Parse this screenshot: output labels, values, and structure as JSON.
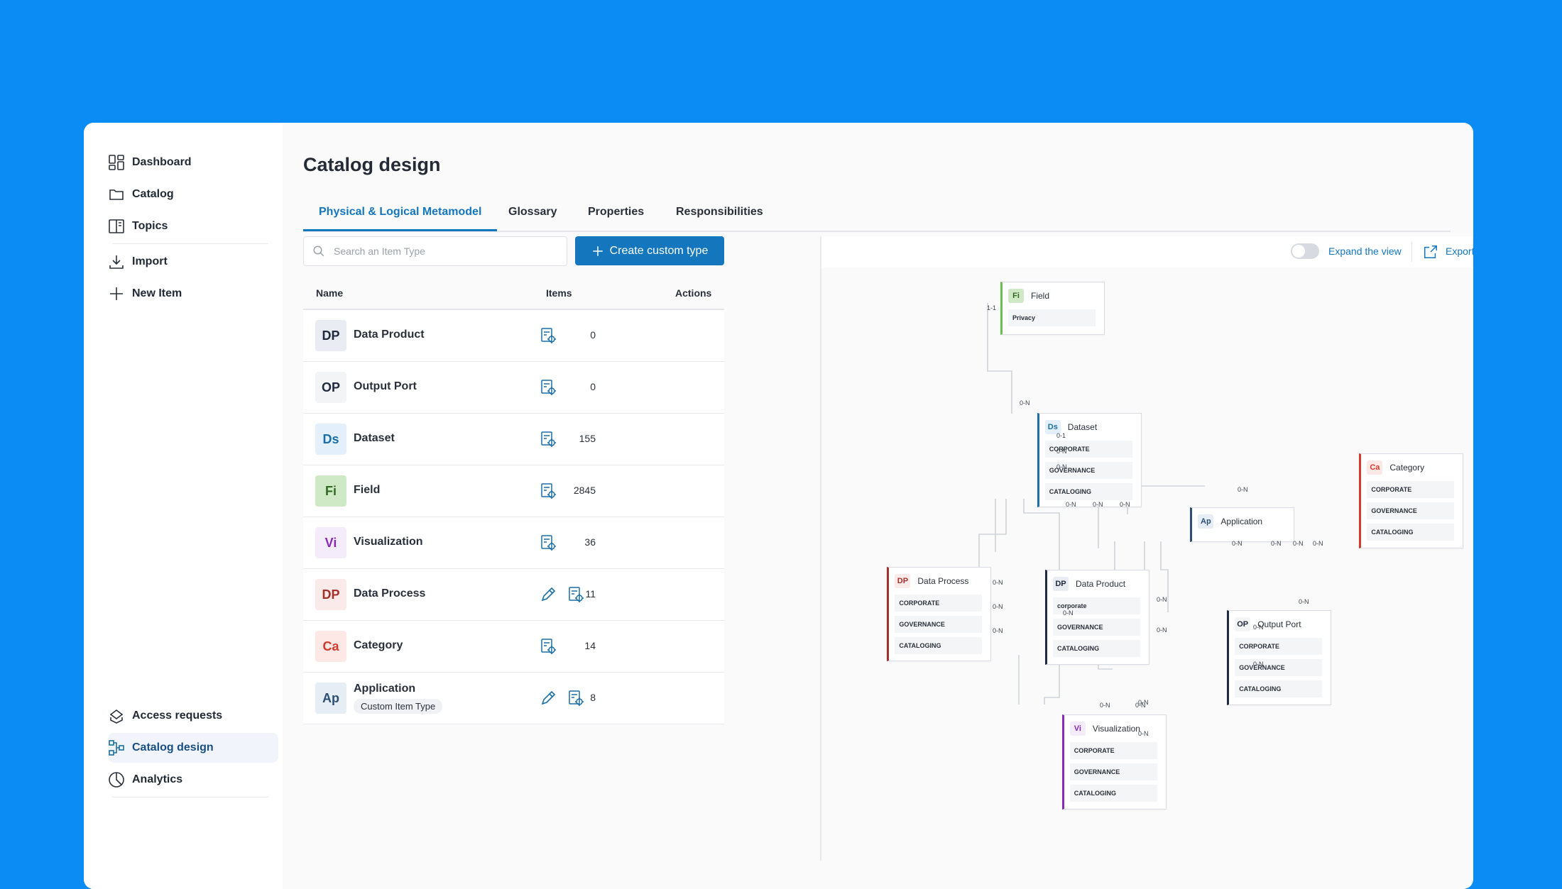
{
  "sidebar": {
    "items": [
      {
        "label": "Dashboard",
        "icon": "dashboard-icon"
      },
      {
        "label": "Catalog",
        "icon": "folder-icon"
      },
      {
        "label": "Topics",
        "icon": "book-icon"
      },
      {
        "label": "Import",
        "icon": "download-icon"
      },
      {
        "label": "New Item",
        "icon": "plus-icon"
      }
    ],
    "bottom_items": [
      {
        "label": "Access requests",
        "icon": "access-requests-icon"
      },
      {
        "label": "Catalog design",
        "icon": "catalog-design-icon",
        "active": true
      },
      {
        "label": "Analytics",
        "icon": "pie-chart-icon"
      }
    ]
  },
  "page": {
    "title": "Catalog design",
    "tabs": [
      {
        "label": "Physical & Logical Metamodel",
        "active": true
      },
      {
        "label": "Glossary"
      },
      {
        "label": "Properties"
      },
      {
        "label": "Responsibilities"
      }
    ]
  },
  "list": {
    "search_placeholder": "Search an Item Type",
    "create_label": "Create custom type",
    "columns": {
      "name": "Name",
      "items": "Items",
      "actions": "Actions"
    },
    "rows": [
      {
        "badge": "DP",
        "name": "Data Product",
        "count": "0",
        "badge_bg": "#e9edf3",
        "badge_fg": "#1f2a3d",
        "editable": false
      },
      {
        "badge": "OP",
        "name": "Output Port",
        "count": "0",
        "badge_bg": "#f3f4f6",
        "badge_fg": "#1f2a3d",
        "editable": false
      },
      {
        "badge": "Ds",
        "name": "Dataset",
        "count": "155",
        "badge_bg": "#e3f0fb",
        "badge_fg": "#1a6fa8",
        "editable": false
      },
      {
        "badge": "Fi",
        "name": "Field",
        "count": "2845",
        "badge_bg": "#cfe8c6",
        "badge_fg": "#2f6b22",
        "editable": false
      },
      {
        "badge": "Vi",
        "name": "Visualization",
        "count": "36",
        "badge_bg": "#f4ecfa",
        "badge_fg": "#8a2bb5",
        "editable": false
      },
      {
        "badge": "DP",
        "name": "Data Process",
        "count": "11",
        "badge_bg": "#fbeaea",
        "badge_fg": "#a3302a",
        "editable": true
      },
      {
        "badge": "Ca",
        "name": "Category",
        "count": "14",
        "badge_bg": "#fde8e6",
        "badge_fg": "#d23a2b",
        "editable": false
      },
      {
        "badge": "Ap",
        "name": "Application",
        "chip": "Custom Item Type",
        "count": "8",
        "badge_bg": "#e6edf5",
        "badge_fg": "#2c4f73",
        "editable": true
      }
    ]
  },
  "diagram": {
    "expand_label": "Expand the view",
    "export_label": "Export as image",
    "nodes": [
      {
        "id": "field",
        "badge": "Fi",
        "label": "Field",
        "attrs": [
          "Privacy"
        ],
        "color": "#6cbf52",
        "badge_bg": "#cfe8c6",
        "badge_fg": "#2f6b22"
      },
      {
        "id": "dataset",
        "badge": "Ds",
        "label": "Dataset",
        "attrs": [
          "CORPORATE",
          "GOVERNANCE",
          "CATALOGING"
        ],
        "color": "#1a6fa8",
        "badge_bg": "#e3f0fb",
        "badge_fg": "#1a6fa8"
      },
      {
        "id": "category",
        "badge": "Ca",
        "label": "Category",
        "attrs": [
          "CORPORATE",
          "GOVERNANCE",
          "CATALOGING"
        ],
        "color": "#d23a2b",
        "badge_bg": "#fde8e6",
        "badge_fg": "#d23a2b"
      },
      {
        "id": "application",
        "badge": "Ap",
        "label": "Application",
        "attrs": [],
        "color": "#2c4f73",
        "badge_bg": "#e6edf5",
        "badge_fg": "#2c4f73"
      },
      {
        "id": "dataprocess",
        "badge": "DP",
        "label": "Data Process",
        "attrs": [
          "CORPORATE",
          "GOVERNANCE",
          "CATALOGING"
        ],
        "color": "#a3302a",
        "badge_bg": "#fbeaea",
        "badge_fg": "#a3302a"
      },
      {
        "id": "dataproduct",
        "badge": "DP",
        "label": "Data Product",
        "attrs": [
          "corporate",
          "GOVERNANCE",
          "CATALOGING"
        ],
        "color": "#1f2a3d",
        "badge_bg": "#e9edf3",
        "badge_fg": "#1f2a3d"
      },
      {
        "id": "outputport",
        "badge": "OP",
        "label": "Output Port",
        "attrs": [
          "CORPORATE",
          "GOVERNANCE",
          "CATALOGING"
        ],
        "color": "#1f2a3d",
        "badge_bg": "#f3f4f6",
        "badge_fg": "#1f2a3d"
      },
      {
        "id": "visualization",
        "badge": "Vi",
        "label": "Visualization",
        "attrs": [
          "CORPORATE",
          "GOVERNANCE",
          "CATALOGING"
        ],
        "color": "#8a2bb5",
        "badge_bg": "#f4ecfa",
        "badge_fg": "#8a2bb5"
      }
    ],
    "edge_labels": [
      "1-1",
      "0-N",
      "0-1",
      "0-N",
      "0-N",
      "0-N",
      "0-N",
      "0-N",
      "0-N",
      "0-N",
      "0-N",
      "0-N",
      "0-N",
      "0-N",
      "0-N",
      "0-N",
      "0-N",
      "0-N",
      "0-N",
      "0-N",
      "0-N",
      "0-N",
      "0-N",
      "0-N",
      "0-N",
      "0-N"
    ]
  },
  "colors": {
    "accent": "#1476bd",
    "background": "#0a8cf4",
    "icon_blue": "#1a6fa8"
  }
}
